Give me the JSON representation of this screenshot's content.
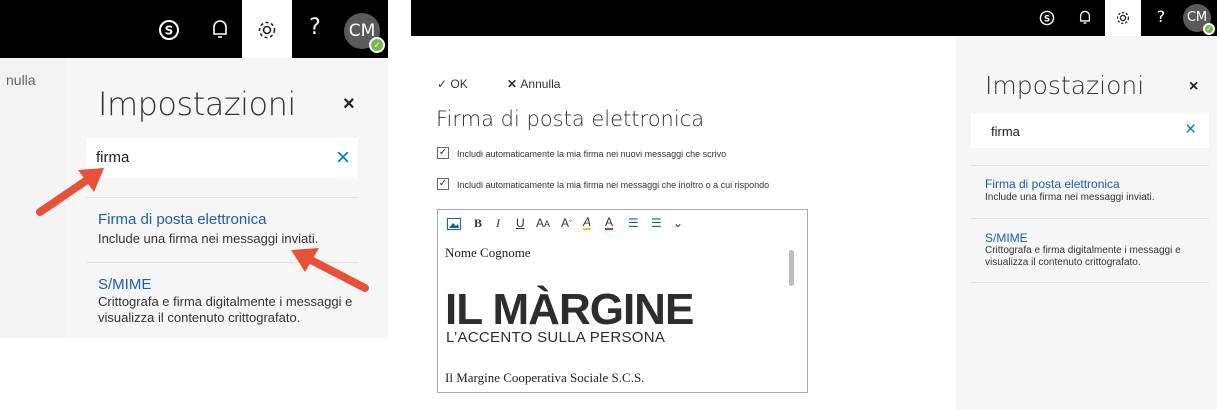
{
  "left_panel": {
    "nav_text": "nulla",
    "settings_title": "Impostazioni",
    "close_icon": "×",
    "search": {
      "value": "firma",
      "clear_icon": "×"
    },
    "results": [
      {
        "title": "Firma di posta elettronica",
        "description": "Include una firma nei messaggi inviati."
      },
      {
        "title": "S/MIME",
        "description": "Crittografa e firma digitalmente i messaggi e visualizza il contenuto crittografato."
      }
    ],
    "topbar": {
      "avatar_initials": "CM"
    }
  },
  "right_panel": {
    "topbar": {
      "avatar_initials": "CM"
    },
    "actions": {
      "ok_label": "OK",
      "cancel_label": "Annulla"
    },
    "form_title": "Firma di posta elettronica",
    "checkboxes": [
      {
        "label": "Includi automaticamente la mia firma nei nuovi messaggi che scrivo",
        "checked": true
      },
      {
        "label": "Includi automaticamente la mia firma nei messaggi che inoltro o a cui rispondo",
        "checked": true
      }
    ],
    "editor": {
      "signature_name": "Nome Cognome",
      "logo_main": "IL MÀRGINE",
      "logo_sub": "L’ACCENTO SULLA PERSONA",
      "company": "Il Margine Cooperativa Sociale S.C.S."
    },
    "settings_title": "Impostazioni",
    "close_icon": "×",
    "search": {
      "value": "firma",
      "clear_icon": "×"
    },
    "results": [
      {
        "title": "Firma di posta elettronica",
        "description": "Include una firma nei messaggi inviati."
      },
      {
        "title": "S/MIME",
        "description": "Crittografa e firma digitalmente i messaggi e visualizza il contenuto crittografato."
      }
    ]
  },
  "colors": {
    "topbar": "#000000",
    "link": "#1a5ea8",
    "accent": "#0078d4",
    "arrow": "#e8503a",
    "badge": "#7ab648"
  }
}
